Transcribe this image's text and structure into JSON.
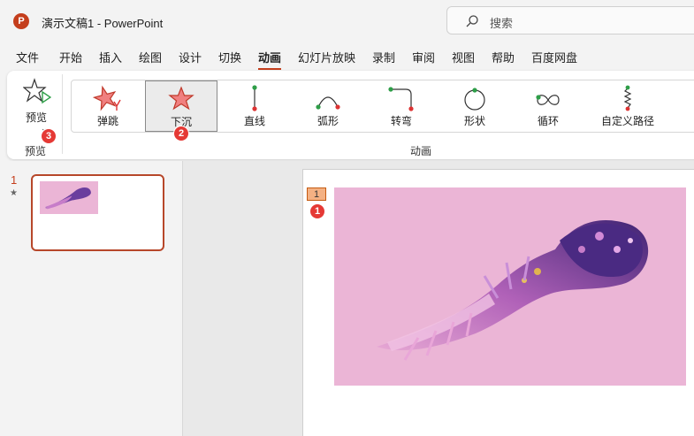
{
  "titlebar": {
    "app_icon": "P",
    "title": "演示文稿1  -  PowerPoint",
    "search_placeholder": "搜索"
  },
  "menu": {
    "tabs": [
      "文件",
      "开始",
      "插入",
      "绘图",
      "设计",
      "切换",
      "动画",
      "幻灯片放映",
      "录制",
      "审阅",
      "视图",
      "帮助",
      "百度网盘"
    ],
    "active": "动画"
  },
  "ribbon": {
    "preview_button_label": "预览",
    "preview_group_label": "预览",
    "animation_group_label": "动画",
    "animations": [
      {
        "label": "弹跳",
        "icon": "bounce-star-icon"
      },
      {
        "label": "下沉",
        "icon": "sink-star-icon",
        "selected": true
      },
      {
        "label": "直线",
        "icon": "line-path-icon"
      },
      {
        "label": "弧形",
        "icon": "arc-path-icon"
      },
      {
        "label": "转弯",
        "icon": "turn-path-icon"
      },
      {
        "label": "形状",
        "icon": "shape-path-icon"
      },
      {
        "label": "循环",
        "icon": "loop-path-icon"
      },
      {
        "label": "自定义路径",
        "icon": "custom-path-icon"
      }
    ]
  },
  "badges": {
    "slide_image": "1",
    "sink": "2",
    "preview": "3"
  },
  "thumbnails": {
    "slide_number": "1",
    "animation_marker": "★"
  },
  "slide": {
    "animation_tag": "1"
  },
  "colors": {
    "accent": "#c43e1c",
    "badge": "#e53935",
    "slide_bg": "#ebb5d6"
  }
}
